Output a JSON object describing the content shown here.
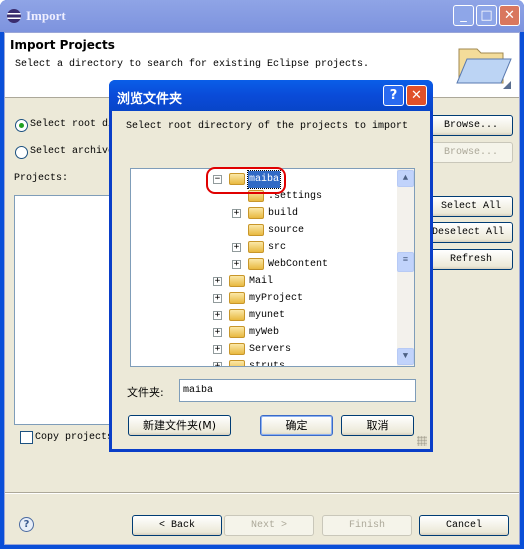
{
  "window": {
    "title": "Import",
    "buttons": [
      "minimize",
      "maximize",
      "close"
    ]
  },
  "header": {
    "title": "Import Projects",
    "description": "Select a directory to search for existing Eclipse projects."
  },
  "form": {
    "radio_root": {
      "label": "Select root directory:",
      "checked": true
    },
    "radio_archive": {
      "label": "Select archive file:",
      "checked": false
    },
    "browse1": "Browse...",
    "browse2": "Browse...",
    "projects_label": "Projects:",
    "select_all": "Select All",
    "deselect_all": "Deselect All",
    "refresh": "Refresh",
    "copy_label": "Copy projects into workspace",
    "copy_checked": false
  },
  "footer": {
    "back": "< Back",
    "next": "Next >",
    "finish": "Finish",
    "cancel": "Cancel"
  },
  "dialog": {
    "title": "浏览文件夹",
    "instruction": "Select root directory of the projects to import",
    "tree": [
      {
        "label": "maiba",
        "level": 0,
        "expander": "minus",
        "selected": true
      },
      {
        "label": ".settings",
        "level": 1,
        "expander": "none"
      },
      {
        "label": "build",
        "level": 1,
        "expander": "plus"
      },
      {
        "label": "source",
        "level": 1,
        "expander": "none"
      },
      {
        "label": "src",
        "level": 1,
        "expander": "plus"
      },
      {
        "label": "WebContent",
        "level": 1,
        "expander": "plus"
      },
      {
        "label": "Mail",
        "level": 0,
        "expander": "plus"
      },
      {
        "label": "myProject",
        "level": 0,
        "expander": "plus"
      },
      {
        "label": "myunet",
        "level": 0,
        "expander": "plus"
      },
      {
        "label": "myWeb",
        "level": 0,
        "expander": "plus"
      },
      {
        "label": "Servers",
        "level": 0,
        "expander": "plus"
      },
      {
        "label": "struts",
        "level": 0,
        "expander": "plus"
      }
    ],
    "folder_label": "文件夹:",
    "folder_value": "maiba",
    "new_folder": "新建文件夹(M)",
    "ok": "确定",
    "cancel": "取消",
    "highlight_color": "#e00000"
  }
}
